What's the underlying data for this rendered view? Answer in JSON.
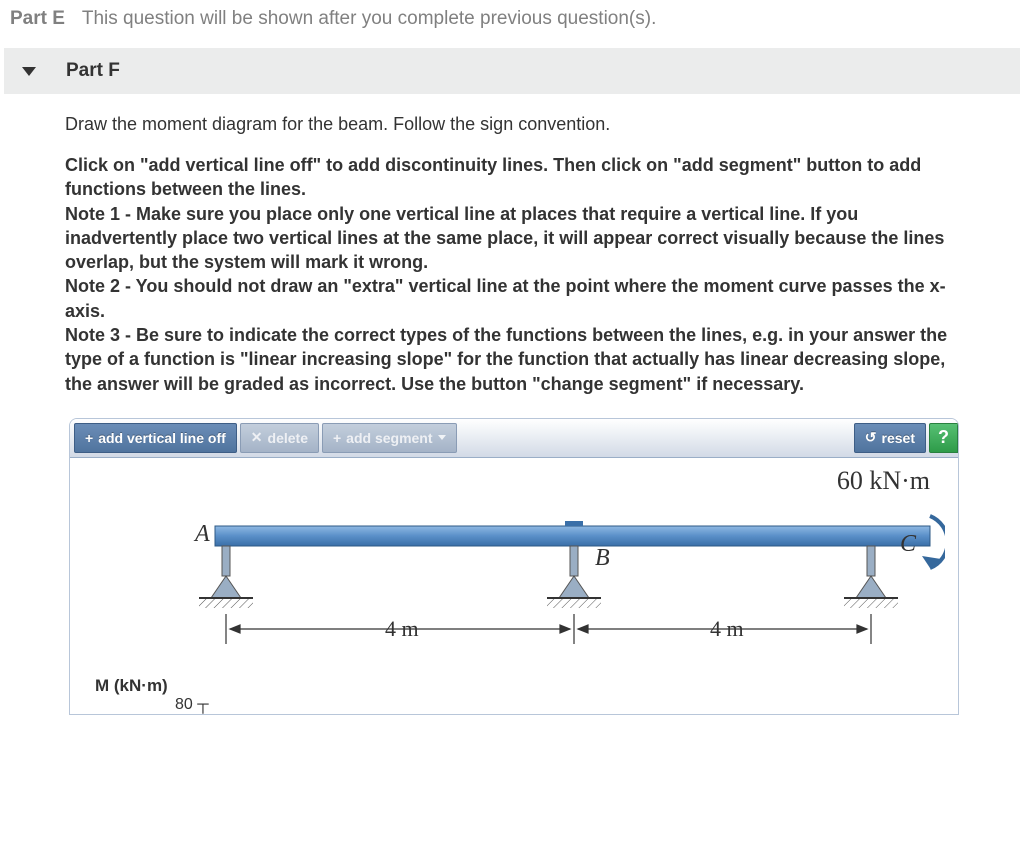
{
  "partE": {
    "label": "Part E",
    "message": "This question will be shown after you complete previous question(s)."
  },
  "partF": {
    "label": "Part F",
    "prompt": "Draw the moment diagram for the beam. Follow the sign convention.",
    "instructions": "Click on \"add vertical line off\" to add discontinuity lines. Then click on \"add segment\" button to add functions between the lines.\nNote 1 - Make sure you place only one vertical line at places that require a vertical line. If you inadvertently place two vertical lines at the same place, it will appear correct visually because the lines overlap, but the system will mark it wrong.\nNote 2 - You should not draw an \"extra\" vertical line at the point where the moment curve passes the x-axis.\nNote 3 - Be sure to indicate the correct types of the functions between the lines, e.g. in your answer the type of a function is \"linear increasing slope\" for the function that actually has linear decreasing slope, the answer will be graded as incorrect. Use the button \"change segment\" if necessary."
  },
  "toolbar": {
    "add_vertical": "add vertical line off",
    "delete": "delete",
    "add_segment": "add segment",
    "reset": "reset",
    "help": "?"
  },
  "beam": {
    "moment_load": "60 kN·m",
    "point_A": "A",
    "point_B": "B",
    "point_C": "C",
    "span1": "4 m",
    "span2": "4 m",
    "y_label": "M (kN·m)",
    "tick0": "80"
  }
}
